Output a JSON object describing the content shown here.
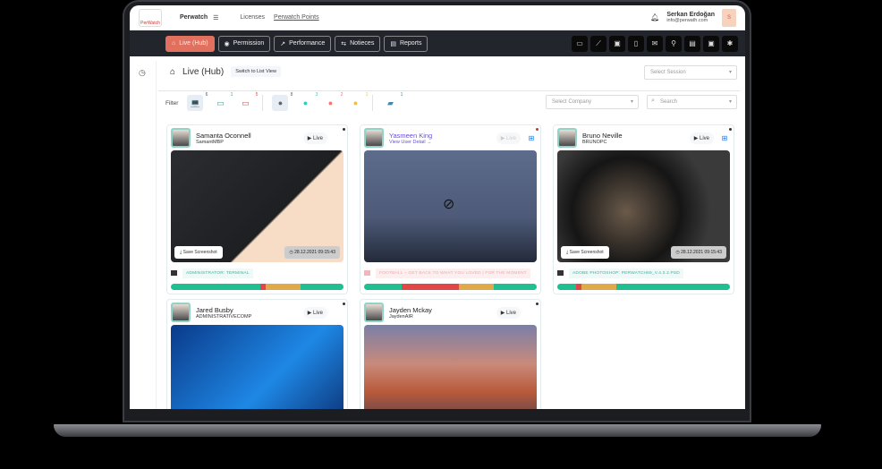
{
  "topbar": {
    "logo": "PerWatch",
    "brand": "Perwatch",
    "menu_icon": "☰",
    "links": [
      "Licenses",
      "Perwatch Points"
    ],
    "user_name": "Serkan Erdoğan",
    "user_email": "info@perwath.com",
    "avatar": "S"
  },
  "nav": {
    "tabs": [
      {
        "label": "Live (Hub)",
        "icon": "⌂",
        "active": true
      },
      {
        "label": "Permission",
        "icon": "◉"
      },
      {
        "label": "Performance",
        "icon": "↗"
      },
      {
        "label": "Notieces",
        "icon": "⇆"
      },
      {
        "label": "Reports",
        "icon": "▤"
      }
    ],
    "tools": [
      "▭",
      "⟋",
      "▣",
      "▯",
      "✉",
      "⚲",
      "▤",
      "▣",
      "✱"
    ]
  },
  "page": {
    "title": "Live (Hub)",
    "switch_label": "Switch to List View",
    "session_placeholder": "Select Session",
    "company_placeholder": "Select Company",
    "search_placeholder": "Search",
    "filter_label": "Filter"
  },
  "filters": [
    {
      "icon": "💻",
      "count": "6",
      "color": "#556"
    },
    {
      "icon": "▭",
      "count": "1",
      "color": "#3a9"
    },
    {
      "icon": "▭",
      "count": "5",
      "color": "#c55"
    },
    {
      "icon": "●",
      "count": "8",
      "color": "#666"
    },
    {
      "icon": "●",
      "count": "3",
      "color": "#3cb"
    },
    {
      "icon": "●",
      "count": "2",
      "color": "#e77"
    },
    {
      "icon": "●",
      "count": "1",
      "color": "#eb5"
    },
    {
      "icon": "▰",
      "count": "1",
      "color": "#48a"
    }
  ],
  "cards": [
    {
      "name": "Samanta Oconnell",
      "sub": "SamantMBP",
      "live": "Live",
      "os": "",
      "save": "Save Screenshot",
      "time": "28.12.2021 09:15:43",
      "activity": "ADMINISTRATOR: TERMINAL",
      "bar": [
        [
          52,
          "#1fbf92"
        ],
        [
          3,
          "#e04848"
        ],
        [
          20,
          "#e0a94a"
        ],
        [
          25,
          "#1fbf92"
        ]
      ]
    },
    {
      "name": "Yasmeen King",
      "sub": "View User Detail →",
      "live": "Live",
      "os": "⊞",
      "activity": "FOOTBALL – GET BACK TO WHAT YOU LOVED | FOR THE MOMENT",
      "bar": [
        [
          22,
          "#1fbf92"
        ],
        [
          33,
          "#e04848"
        ],
        [
          20,
          "#e0a94a"
        ],
        [
          25,
          "#1fbf92"
        ]
      ]
    },
    {
      "name": "Bruno Neville",
      "sub": "BRUNOPC",
      "live": "Live",
      "os": "⊞",
      "save": "Save Screenshot",
      "time": "28.12.2021 09:15:43",
      "activity": "ADOBE PHOTOSHOP: PERWATCH69_V.4.3.2.PSD",
      "bar": [
        [
          11,
          "#1fbf92"
        ],
        [
          3,
          "#e04848"
        ],
        [
          20,
          "#e0a94a"
        ],
        [
          66,
          "#1fbf92"
        ]
      ]
    },
    {
      "name": "Jared Busby",
      "sub": "ADMINISTRATIVECOMP",
      "live": "Live",
      "os": ""
    },
    {
      "name": "Jayden Mckay",
      "sub": "JaydenAIR",
      "live": "Live",
      "os": ""
    }
  ]
}
